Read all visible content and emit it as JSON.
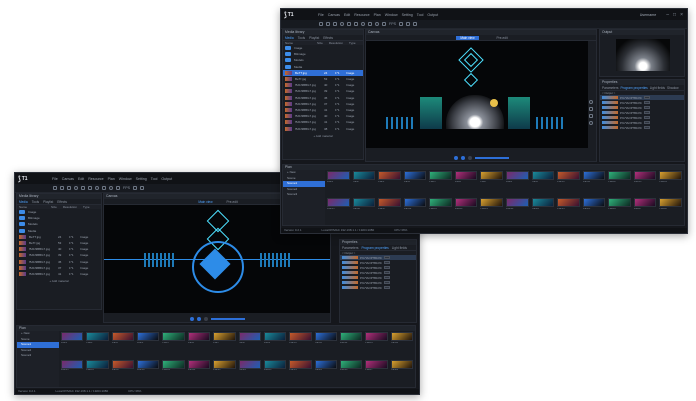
{
  "app": {
    "brand": "T1",
    "menu": [
      "File",
      "Canvas",
      "Edit",
      "Resource",
      "Plan",
      "Window",
      "Setting",
      "Tool",
      "Output"
    ],
    "user": "Username"
  },
  "toolbar": {
    "fps_label": "FPS"
  },
  "media_library": {
    "title": "Media library",
    "tabs": [
      "Media",
      "Tools",
      "Playlist",
      "Effects"
    ],
    "columns": [
      "Name",
      "Size",
      "Resolution",
      "Type"
    ],
    "folders": [
      "Image",
      "Bitimage",
      "Models",
      "Media"
    ],
    "files": [
      {
        "name": "BeTT.jpg",
        "size": "24",
        "res": "1*1",
        "type": "Image"
      },
      {
        "name": "BeTf.jpg",
        "size": "53",
        "res": "1*1",
        "type": "Image"
      },
      {
        "name": "f5J1f3BBG7.jpg",
        "size": "40",
        "res": "1*1",
        "type": "Image"
      },
      {
        "name": "f5J1f3BBG7.jpg",
        "size": "39",
        "res": "1*1",
        "type": "Image"
      },
      {
        "name": "f5J1f3BBG7.jpg",
        "size": "45",
        "res": "1*1",
        "type": "Image"
      },
      {
        "name": "f5J1f3BBG7.jpg",
        "size": "37",
        "res": "1*1",
        "type": "Image"
      },
      {
        "name": "f5J1f3BBG7.jpg",
        "size": "41",
        "res": "1*1",
        "type": "Image"
      },
      {
        "name": "f5J1f3BBG7.jpg",
        "size": "40",
        "res": "1*1",
        "type": "Image"
      },
      {
        "name": "f5J1f3BBG7.jpg",
        "size": "41",
        "res": "1*1",
        "type": "Image"
      },
      {
        "name": "f5J1f3BBG7.jpg",
        "size": "38",
        "res": "1*1",
        "type": "Image"
      }
    ],
    "add_label": "+ Add material"
  },
  "canvas": {
    "title": "Canvas",
    "tab_main": "Main view",
    "tab_edit": "Pre-edit"
  },
  "output_panel": {
    "title": "Output"
  },
  "properties": {
    "title": "Properties",
    "tabs": [
      "Parameters",
      "Program properties",
      "Light fields",
      "Shadow"
    ],
    "group": "< Output >",
    "items": [
      "P/G*IAOP7B1hf0.mp4",
      "P/G*IAOP7B1hf0.mp4",
      "P/G*IAOP7B1hf0.mp4",
      "P/G*IAOP7B1hf0.mp4",
      "P/G*IAOP7B1hf0.mp4",
      "P/G*IAOP7B1hf0.mp4",
      "P/G*IAOP7B1hf0.mp4"
    ]
  },
  "plan": {
    "title": "Plan",
    "new_label": "+ New",
    "items": [
      "Scene",
      "Scene1",
      "Scene2",
      "Scene3"
    ],
    "thumb_labels": [
      "Plan1",
      "Plan2",
      "Plan3",
      "Plan4",
      "Plan5",
      "Plan6",
      "Plan7",
      "Plan8",
      "Plan9",
      "Plan10",
      "Plan11",
      "Plan12",
      "Plan13",
      "Plan14",
      "Plan15",
      "Plan16",
      "Plan17",
      "Plan18",
      "Plan19",
      "Plan20",
      "Plan21",
      "Plan22",
      "Plan23",
      "Plan24",
      "Plan25",
      "Plan26",
      "Plan27",
      "Plan28"
    ]
  },
  "status": {
    "version": "Version 0.2.1",
    "info": "Local:IP/MAC 192.168.1.1 / 1920×1080",
    "cpu": "CPU 36%"
  },
  "colors": {
    "accent": "#2f6fd6",
    "cyan": "#4de0ff",
    "bg": "#15171c"
  }
}
